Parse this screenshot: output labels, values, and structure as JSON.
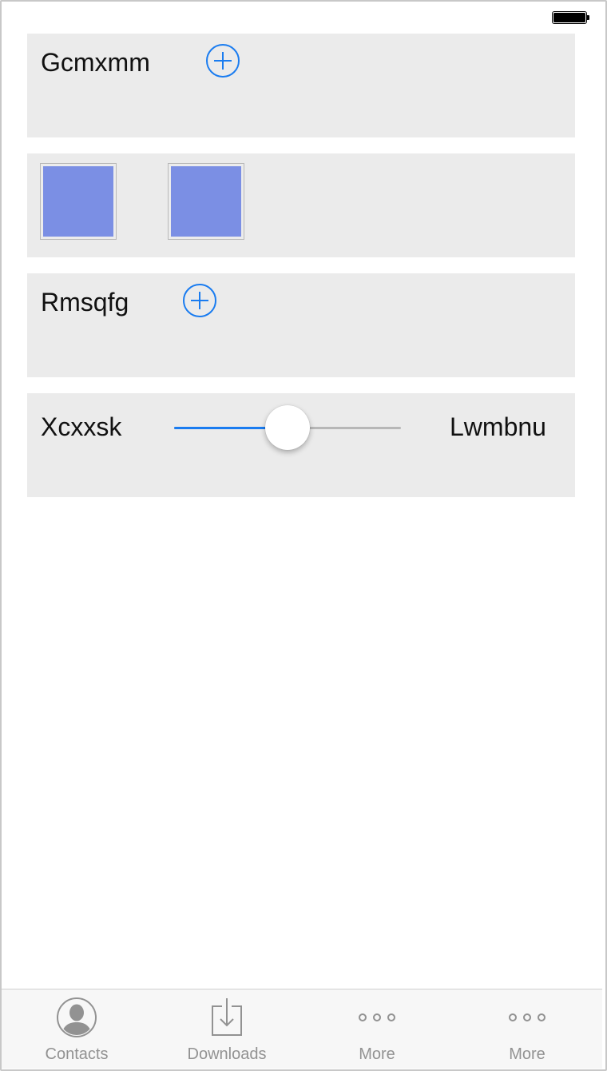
{
  "status_bar": {
    "battery_level": 1.0
  },
  "cards": [
    {
      "label": "Gcmxmm",
      "action": "add-icon"
    },
    {
      "swatches": [
        "#7b8fe4",
        "#7b8fe4"
      ]
    },
    {
      "label": "Rmsqfg",
      "action": "add-icon"
    },
    {
      "min_label": "Xcxxsk",
      "max_label": "Lwmbnu",
      "slider_value": 0.5
    }
  ],
  "colors": {
    "accent": "#1a7cf0",
    "card_background": "#ebebeb",
    "swatch": "#7b8fe4",
    "tab_inactive": "#929292"
  },
  "tabs": [
    {
      "label": "Contacts",
      "icon": "contact-icon"
    },
    {
      "label": "Downloads",
      "icon": "download-icon"
    },
    {
      "label": "More",
      "icon": "more-icon"
    },
    {
      "label": "More",
      "icon": "more-icon"
    }
  ]
}
